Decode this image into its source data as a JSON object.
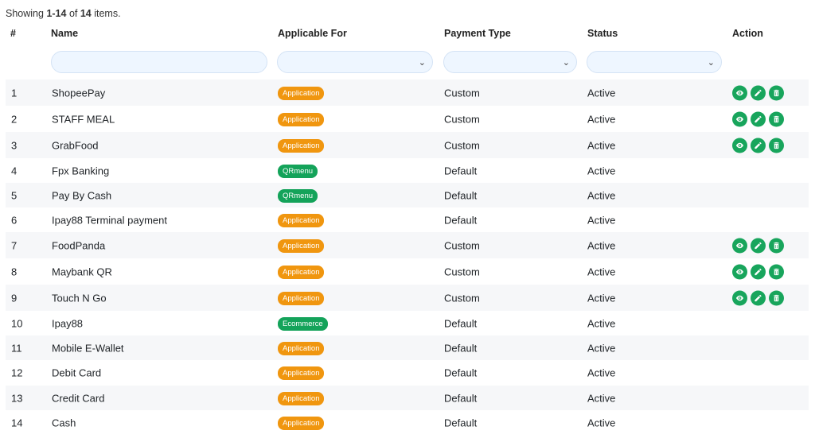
{
  "summary": {
    "prefix": "Showing ",
    "range": "1-14",
    "mid": " of ",
    "total": "14",
    "suffix": " items."
  },
  "columns": [
    "#",
    "Name",
    "Applicable For",
    "Payment Type",
    "Status",
    "Action"
  ],
  "filters": {
    "name_value": "",
    "applicable_value": "",
    "payment_value": "",
    "status_value": ""
  },
  "badge_colors": {
    "Application": "#f0960f",
    "QRmenu": "#14a35a",
    "Ecommerce": "#14a35a"
  },
  "action_color": "#18a55c",
  "rows": [
    {
      "no": "1",
      "name": "ShopeePay",
      "applicable": "Application",
      "payment": "Custom",
      "status": "Active",
      "actions": [
        "view-icon",
        "edit-icon",
        "delete-icon"
      ]
    },
    {
      "no": "2",
      "name": "STAFF MEAL",
      "applicable": "Application",
      "payment": "Custom",
      "status": "Active",
      "actions": [
        "view-icon",
        "edit-icon",
        "delete-icon"
      ]
    },
    {
      "no": "3",
      "name": "GrabFood",
      "applicable": "Application",
      "payment": "Custom",
      "status": "Active",
      "actions": [
        "view-icon",
        "edit-icon",
        "delete-icon"
      ]
    },
    {
      "no": "4",
      "name": "Fpx Banking",
      "applicable": "QRmenu",
      "payment": "Default",
      "status": "Active",
      "actions": []
    },
    {
      "no": "5",
      "name": "Pay By Cash",
      "applicable": "QRmenu",
      "payment": "Default",
      "status": "Active",
      "actions": []
    },
    {
      "no": "6",
      "name": "Ipay88 Terminal payment",
      "applicable": "Application",
      "payment": "Default",
      "status": "Active",
      "actions": []
    },
    {
      "no": "7",
      "name": "FoodPanda",
      "applicable": "Application",
      "payment": "Custom",
      "status": "Active",
      "actions": [
        "view-icon",
        "edit-icon",
        "delete-icon"
      ]
    },
    {
      "no": "8",
      "name": "Maybank QR",
      "applicable": "Application",
      "payment": "Custom",
      "status": "Active",
      "actions": [
        "view-icon",
        "edit-icon",
        "delete-icon"
      ]
    },
    {
      "no": "9",
      "name": "Touch N Go",
      "applicable": "Application",
      "payment": "Custom",
      "status": "Active",
      "actions": [
        "view-icon",
        "edit-icon",
        "delete-icon"
      ]
    },
    {
      "no": "10",
      "name": "Ipay88",
      "applicable": "Ecommerce",
      "payment": "Default",
      "status": "Active",
      "actions": []
    },
    {
      "no": "11",
      "name": "Mobile E-Wallet",
      "applicable": "Application",
      "payment": "Default",
      "status": "Active",
      "actions": []
    },
    {
      "no": "12",
      "name": "Debit Card",
      "applicable": "Application",
      "payment": "Default",
      "status": "Active",
      "actions": []
    },
    {
      "no": "13",
      "name": "Credit Card",
      "applicable": "Application",
      "payment": "Default",
      "status": "Active",
      "actions": []
    },
    {
      "no": "14",
      "name": "Cash",
      "applicable": "Application",
      "payment": "Default",
      "status": "Active",
      "actions": []
    }
  ]
}
